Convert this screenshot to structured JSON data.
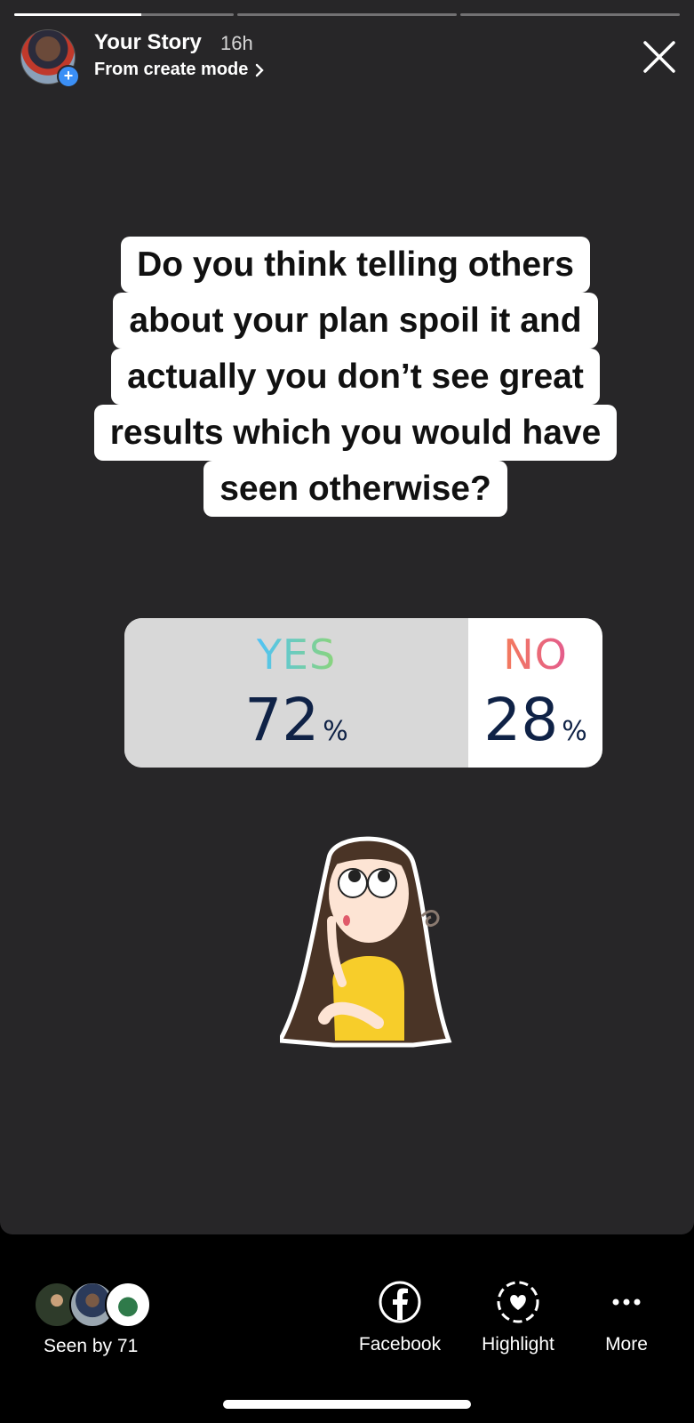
{
  "progress": {
    "segments": 3,
    "current_fill": 0.58
  },
  "header": {
    "title": "Your Story",
    "time": "16h",
    "subtitle": "From create mode",
    "plus": "+"
  },
  "question": {
    "lines": [
      "Do you think telling others",
      "about your plan spoil it and",
      "actually you don’t see great",
      "results which you would have",
      "seen otherwise?"
    ]
  },
  "poll": {
    "options": [
      {
        "label": "YES",
        "percent": "72",
        "color_from": "#4fc3f7",
        "color_to": "#8bd47a"
      },
      {
        "label": "NO",
        "percent": "28",
        "color_from": "#f47b5c",
        "color_to": "#e35c8e"
      }
    ],
    "percent_sign": "%"
  },
  "footer": {
    "seen_by": "Seen by 71",
    "actions": [
      {
        "label": "Facebook",
        "icon": "facebook-icon"
      },
      {
        "label": "Highlight",
        "icon": "highlight-icon"
      },
      {
        "label": "More",
        "icon": "more-icon"
      }
    ]
  },
  "colors": {
    "story_bg": "#272628",
    "page_bg": "#000000",
    "poll_pct": "#0f2246",
    "yes_fill": "#d8d8d8"
  }
}
